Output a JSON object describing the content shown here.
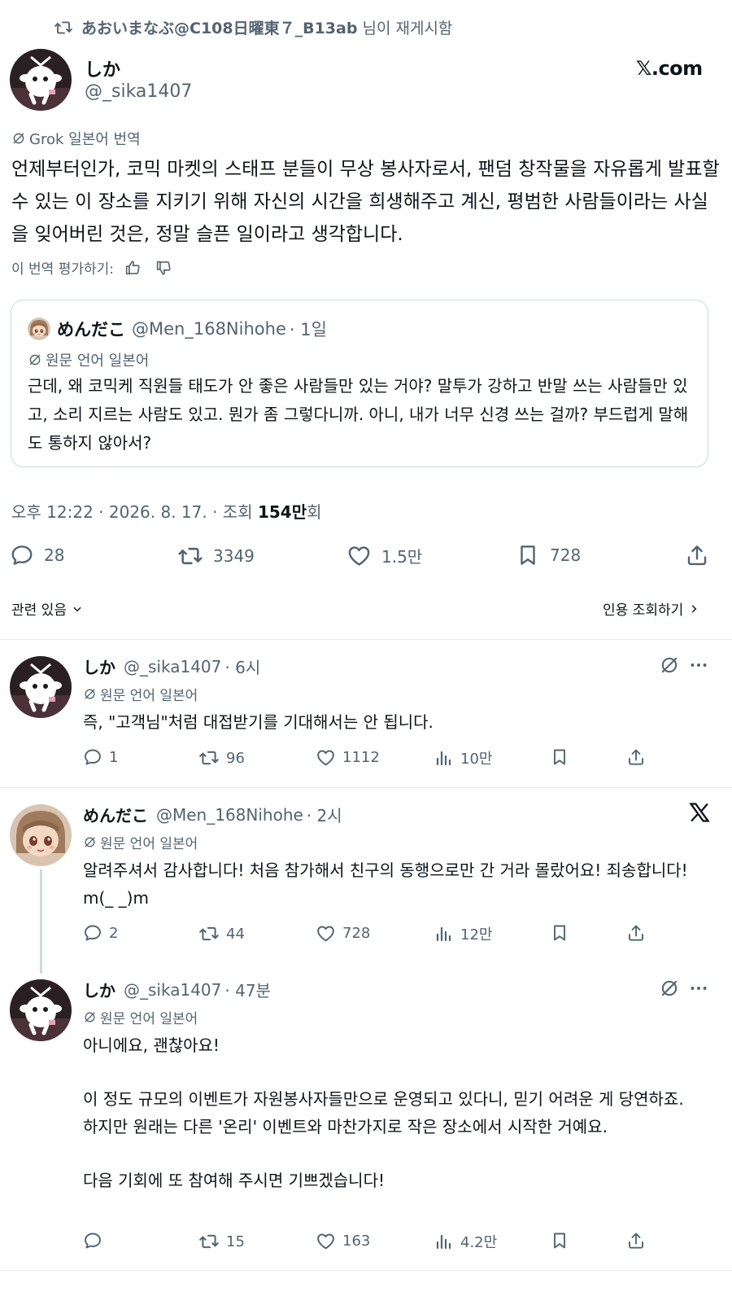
{
  "retweet": {
    "icon": "retweet-icon",
    "reposter": "あおいまなぶ@C108日曜東７_B13ab",
    "suffix": " 님이 재게시함"
  },
  "main": {
    "name": "しか",
    "handle": "@_sika1407",
    "brand": "𝕏.com",
    "grok_label": "Grok 일본어 번역",
    "text": "언제부터인가, 코믹 마켓의 스태프 분들이 무상 봉사자로서, 팬덤 창작물을 자유롭게 발표할 수 있는 이 장소를 지키기 위해 자신의 시간을 희생해주고 계신, 평범한 사람들이라는 사실을 잊어버린 것은, 정말 슬픈 일이라고 생각합니다.",
    "rate_label": "이 번역 평가하기:",
    "quote": {
      "name": "めんだこ",
      "handle": "@Men_168Nihohe",
      "time": "· 1일",
      "lang": "원문 언어 일본어",
      "text": "근데, 왜 코믹케 직원들 태도가 안 좋은 사람들만 있는 거야? 말투가 강하고 반말 쓰는 사람들만 있고, 소리 지르는 사람도 있고. 뭔가 좀 그렇다니까. 아니, 내가 너무 신경 쓰는 걸까? 부드럽게 말해도 통하지 않아서?"
    },
    "meta_prefix": "오후 12:22 · 2026. 8. 17. · 조회 ",
    "views": "154만",
    "meta_suffix": "회",
    "stats": {
      "replies": "28",
      "reposts": "3349",
      "likes": "1.5만",
      "bookmarks": "728"
    },
    "related_label": "관련 있음",
    "quote_views_label": "인용 조회하기"
  },
  "replies": [
    {
      "name": "しか",
      "handle": "@_sika1407",
      "time": "· 6시",
      "lang": "원문 언어 일본어",
      "text": "즉, \"고객님\"처럼 대접받기를 기대해서는 안 됩니다.",
      "replies": "1",
      "reposts": "96",
      "likes": "1112",
      "views": "10만"
    },
    {
      "name": "めんだこ",
      "handle": "@Men_168Nihohe",
      "time": "· 2시",
      "lang": "원문 언어 일본어",
      "text": "알려주셔서 감사합니다! 처음 참가해서 친구의 동행으로만 간 거라 몰랐어요! 죄송합니다! m(_ _)m",
      "replies": "2",
      "reposts": "44",
      "likes": "728",
      "views": "12만"
    },
    {
      "name": "しか",
      "handle": "@_sika1407",
      "time": "· 47분",
      "lang": "원문 언어 일본어",
      "text_lines": [
        "아니에요, 괜찮아요!",
        "이 정도 규모의 이벤트가 자원봉사자들만으로 운영되고 있다니, 믿기 어려운 게 당연하죠.",
        "하지만 원래는 다른 '온리' 이벤트와 마찬가지로 작은 장소에서 시작한 거예요.",
        "다음 기회에 또 참여해 주시면 기쁘겠습니다!"
      ],
      "replies": "",
      "reposts": "15",
      "likes": "163",
      "views": "4.2만"
    }
  ]
}
